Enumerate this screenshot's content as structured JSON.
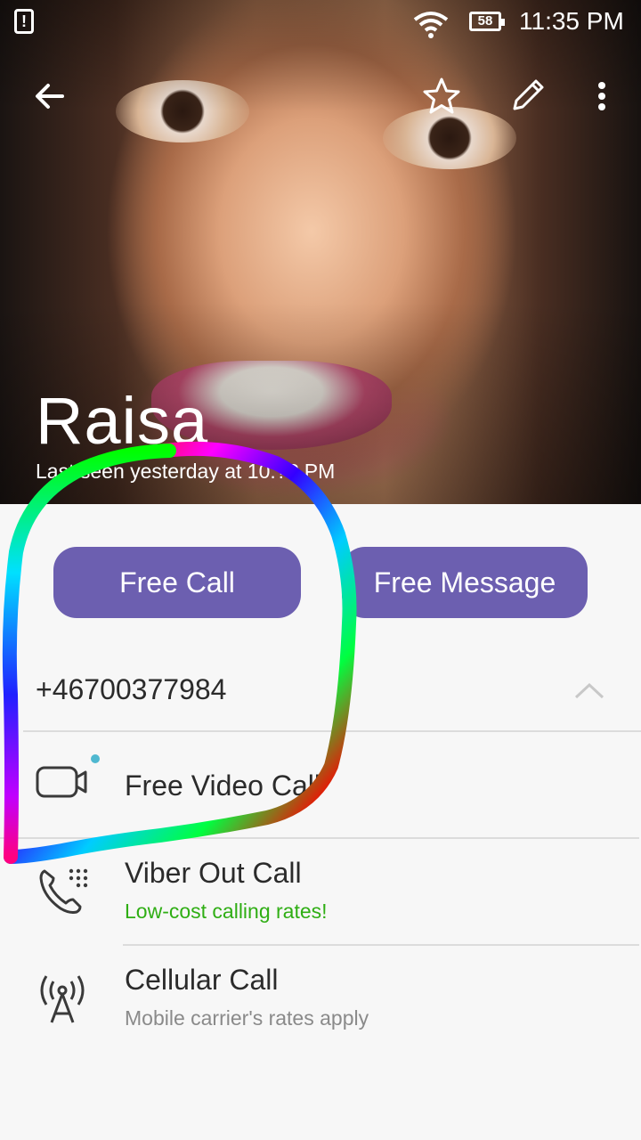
{
  "status_bar": {
    "alert_icon": "alert-icon",
    "battery": "58",
    "time": "11:35 PM"
  },
  "header": {
    "back_icon": "back-arrow-icon",
    "favorite_icon": "star-icon",
    "edit_icon": "pencil-icon",
    "more_icon": "more-vert-icon"
  },
  "contact": {
    "name": "Raisa",
    "last_seen": "Last seen yesterday at 10:?? PM"
  },
  "actions": {
    "free_call": "Free Call",
    "free_message": "Free Message"
  },
  "phone": {
    "number": "+46700377984",
    "toggle_icon": "chevron-up-icon"
  },
  "options": [
    {
      "title": "Free Video Call",
      "subtitle": "",
      "icon": "video-camera-icon"
    },
    {
      "title": "Viber Out Call",
      "subtitle": "Low-cost calling rates!",
      "icon": "phone-dialpad-icon"
    },
    {
      "title": "Cellular Call",
      "subtitle": "Mobile carrier's rates apply",
      "icon": "cell-tower-icon"
    }
  ],
  "colors": {
    "accent": "#6c5fb0",
    "green_text": "#2fae14",
    "badge_dot": "#4fb8d0"
  }
}
